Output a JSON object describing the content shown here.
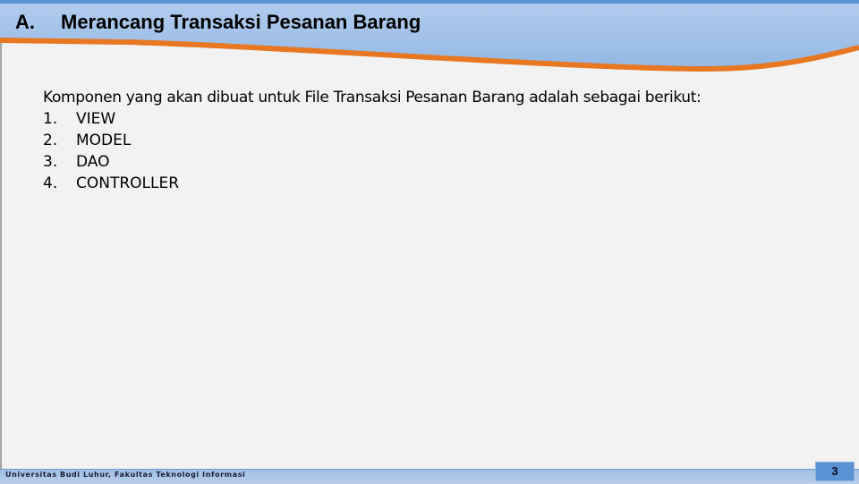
{
  "header": {
    "section_letter": "A.",
    "title": "Merancang Transaksi Pesanan Barang",
    "colors": {
      "band_top": "#5b92d4",
      "band": "#a7c5e9",
      "accent_curve": "#e87722"
    }
  },
  "content": {
    "intro": "Komponen yang akan dibuat untuk File Transaksi Pesanan Barang adalah sebagai berikut:",
    "items": [
      {
        "number": "1.",
        "label": "VIEW"
      },
      {
        "number": "2.",
        "label": "MODEL"
      },
      {
        "number": "3.",
        "label": "DAO"
      },
      {
        "number": "4.",
        "label": "CONTROLLER"
      }
    ]
  },
  "footer": {
    "institution": "Universitas Budi Luhur, Fakultas Teknologi Informasi",
    "page_number": "3"
  }
}
